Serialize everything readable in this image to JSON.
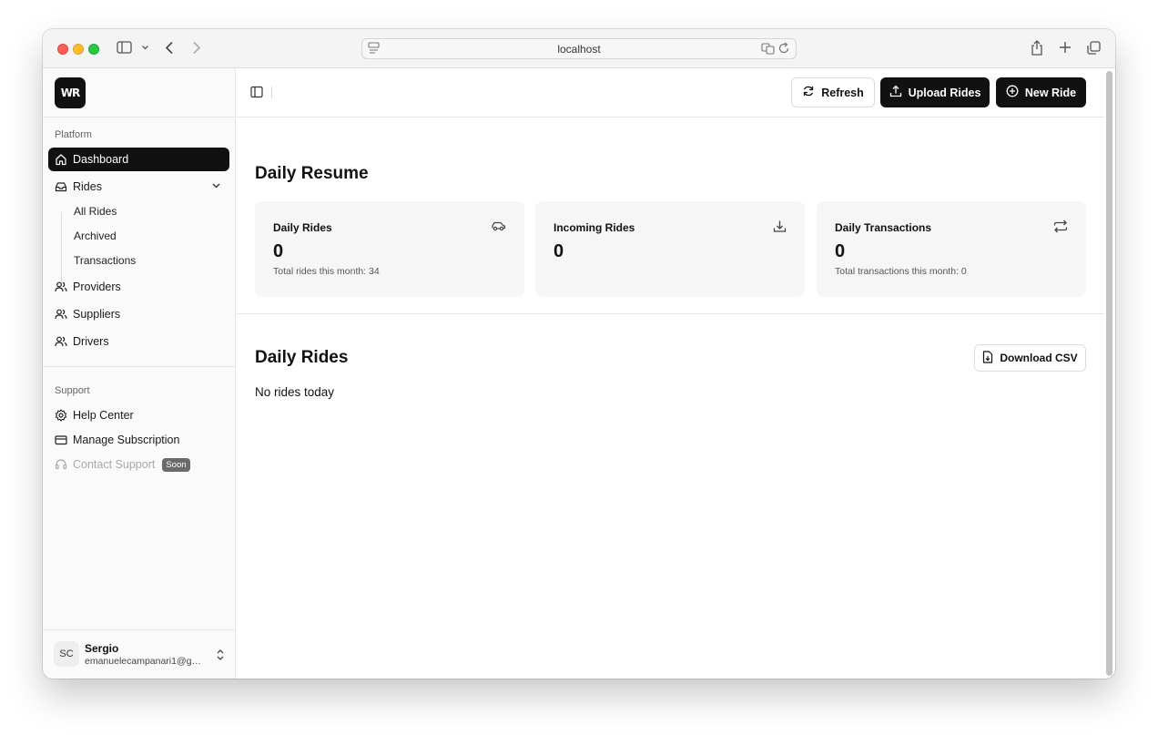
{
  "browser": {
    "url": "localhost"
  },
  "app": {
    "logo_text": "WR"
  },
  "sidebar": {
    "platform_label": "Platform",
    "nav": {
      "dashboard": "Dashboard",
      "rides": "Rides",
      "all_rides": "All Rides",
      "archived": "Archived",
      "transactions": "Transactions",
      "providers": "Providers",
      "suppliers": "Suppliers",
      "drivers": "Drivers"
    },
    "support_label": "Support",
    "support": {
      "help_center": "Help Center",
      "manage_subscription": "Manage Subscription",
      "contact_support": "Contact Support",
      "soon_badge": "Soon"
    },
    "user": {
      "initials": "SC",
      "name": "Sergio",
      "email": "emanuelecampanari1@gmail.com"
    }
  },
  "toolbar": {
    "refresh": "Refresh",
    "upload_rides": "Upload Rides",
    "new_ride": "New Ride"
  },
  "daily_resume": {
    "title": "Daily Resume",
    "cards": [
      {
        "title": "Daily Rides",
        "value": "0",
        "sub": "Total rides this month: 34",
        "icon": "car-icon"
      },
      {
        "title": "Incoming Rides",
        "value": "0",
        "sub": "",
        "icon": "download-icon"
      },
      {
        "title": "Daily Transactions",
        "value": "0",
        "sub": "Total transactions this month: 0",
        "icon": "arrows-exchange-icon"
      }
    ]
  },
  "daily_rides": {
    "title": "Daily Rides",
    "download_csv": "Download CSV",
    "empty": "No rides today"
  }
}
